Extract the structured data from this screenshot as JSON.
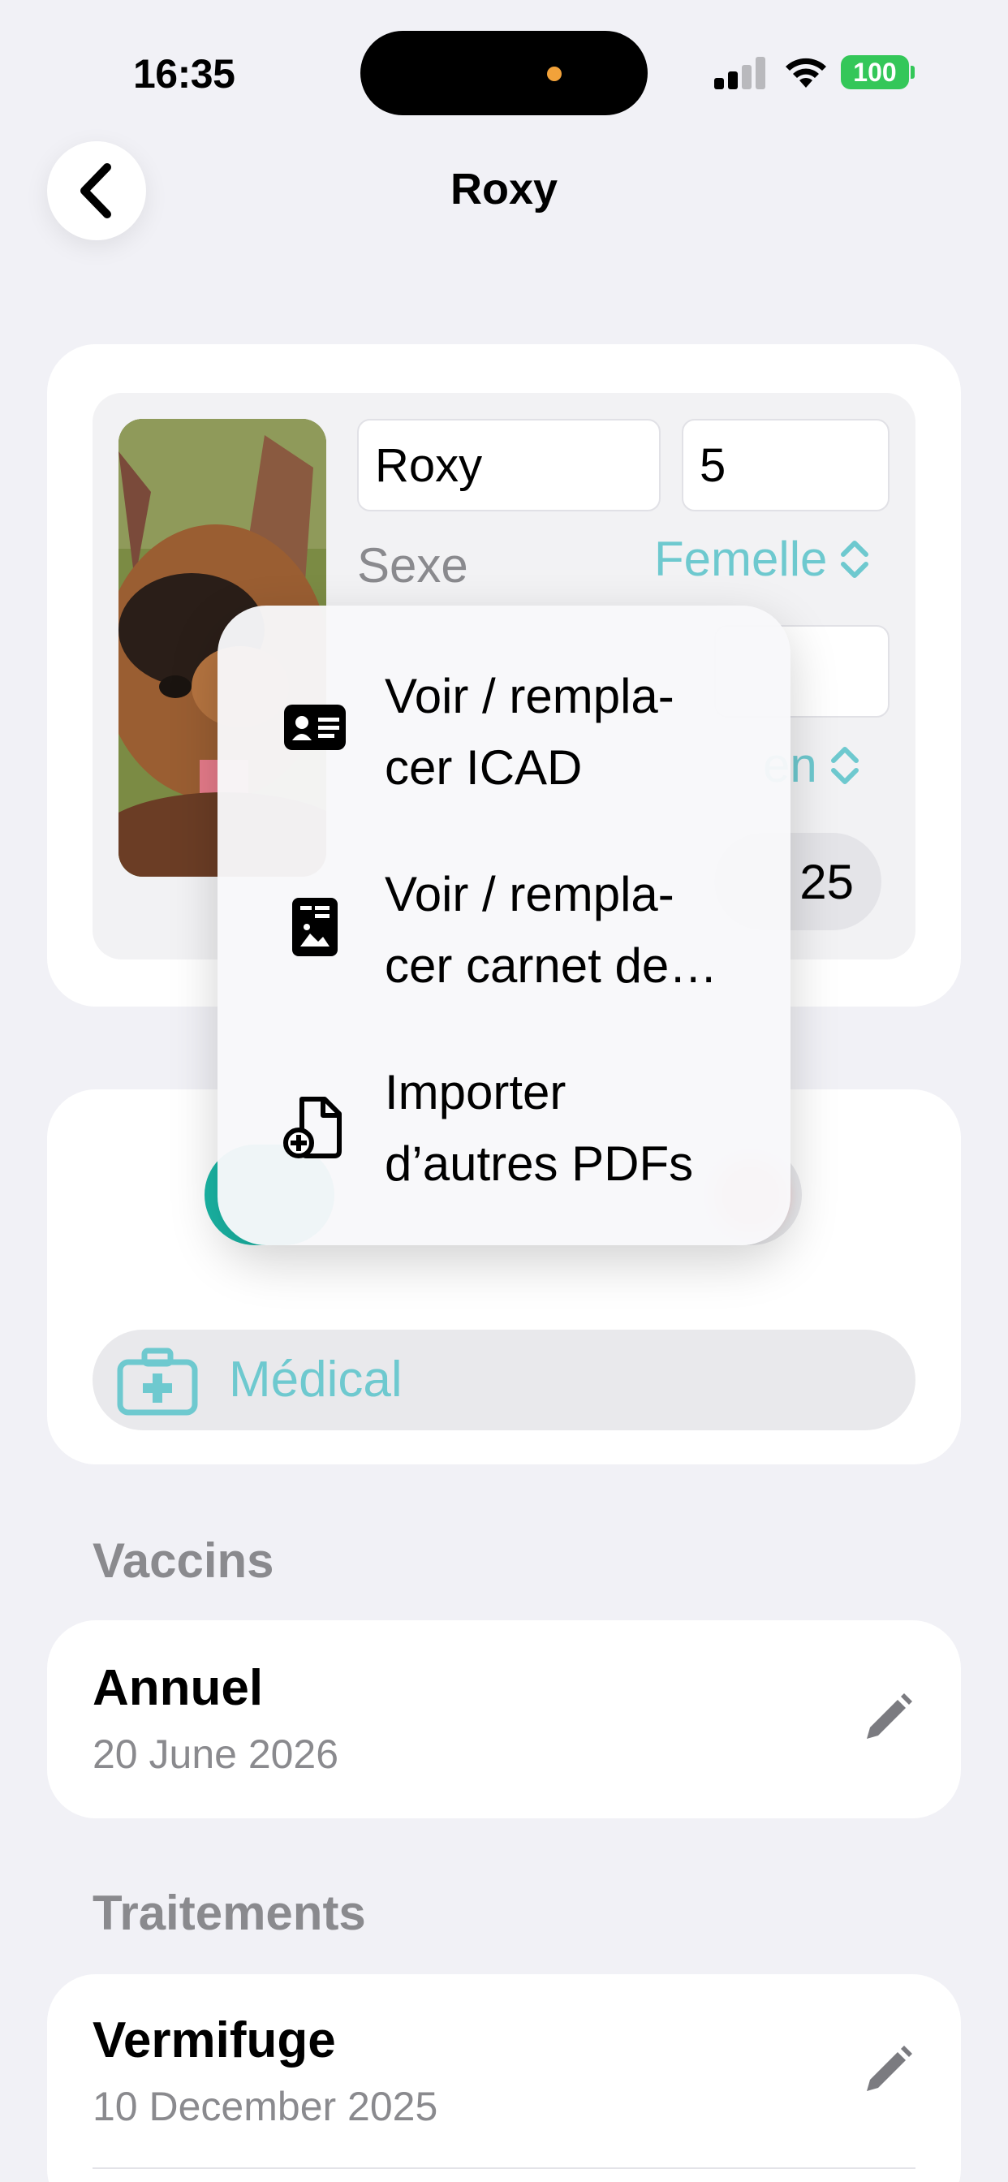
{
  "status_bar": {
    "time": "16:35",
    "battery": "100",
    "battery_color": "#34c759"
  },
  "nav": {
    "title": "Roxy",
    "back_icon": "chevron-left-icon"
  },
  "profile": {
    "name_value": "Roxy",
    "age_value": "5",
    "sex_label": "Sexe",
    "sex_value": "Femelle",
    "size_partial": "en",
    "date_partial": "25"
  },
  "context_menu": {
    "items": [
      {
        "label_line1": "Voir / rempla-",
        "label_line2": "cer ICAD",
        "icon": "id-card-icon"
      },
      {
        "label_line1": "Voir / rempla-",
        "label_line2": "cer carnet de…",
        "icon": "document-image-icon"
      },
      {
        "label_line1": "Importer",
        "label_line2": "d’autres PDFs",
        "icon": "document-add-icon"
      }
    ]
  },
  "medical": {
    "label": "Médical",
    "icon": "medical-kit-icon"
  },
  "vaccins": {
    "section_title": "Vaccins",
    "items": [
      {
        "title": "Annuel",
        "date": "20 June 2026"
      }
    ]
  },
  "traitements": {
    "section_title": "Traitements",
    "items": [
      {
        "title": "Vermifuge",
        "date": "10 December 2025"
      }
    ]
  },
  "colors": {
    "accent": "#6ec9cf",
    "toggle_green": "#1ab7a6",
    "background": "#f1f1f6"
  }
}
